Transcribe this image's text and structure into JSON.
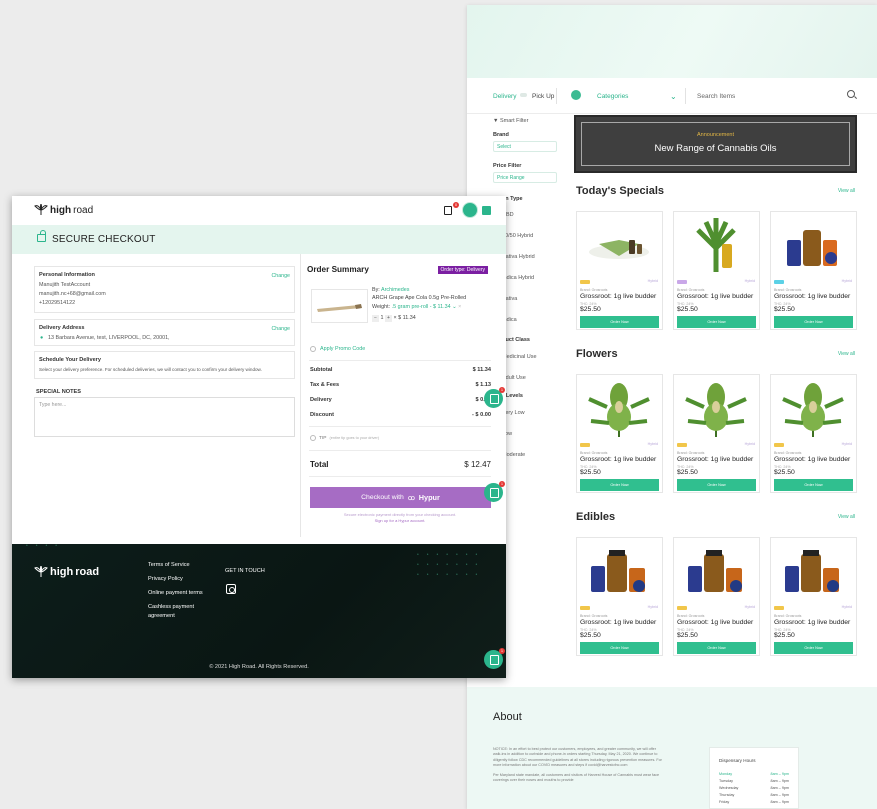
{
  "store": {
    "topbar": {
      "delivery": "Delivery",
      "pickup": "Pick Up",
      "categories": "Categories",
      "search_placeholder": "Search Items"
    },
    "filters": {
      "smart_filter": "Smart Filter",
      "brand_label": "Brand",
      "brand_select": "Select",
      "price_label": "Price Filter",
      "price_select": "Price Range",
      "strain_label": "Strain Type",
      "strains": [
        "CBD",
        "50/50 Hybrid",
        "Sativa Hybrid",
        "Indica Hybrid",
        "Sativa",
        "Indica"
      ],
      "product_class_label": "Product Class",
      "classes": [
        "Medicinal Use",
        "Adult Use"
      ],
      "thc_label": "THC Levels",
      "levels": [
        "Very Low",
        "Low",
        "Moderate"
      ]
    },
    "banner": {
      "announcement": "Announcement",
      "title": "New Range of Cannabis Oils"
    },
    "view_all": "View all",
    "sections": [
      {
        "title": "Today's Specials"
      },
      {
        "title": "Flowers"
      },
      {
        "title": "Edibles"
      }
    ],
    "product": {
      "type": "Hybrid",
      "brand": "Brand: Grosroots",
      "name": "Grossroot: 1g live budder",
      "thc": "THC: 24%",
      "price": "$25.50",
      "order": "Order Now"
    },
    "about": {
      "title": "About",
      "p1": "NOTICE: In an effort to best protect our customers, employees, and greater community, we will offer walk-ins in addition to curbside and phone-in orders starting Thursday, May 21, 2020. We continue to diligently follow CDC recommended guidelines at all stores including rigorous prevention measures. For more information about our COVID measures and steps if covid@harvestofnc.com",
      "p2": "Per Maryland state mandate, all customers and visitors of Harvest House of Cannabis must wear face coverings over their noses and mouths to provide",
      "hours_title": "Dispensary Hours",
      "hours": [
        {
          "day": "Monday",
          "time": "8am – 9pm"
        },
        {
          "day": "Tuesday",
          "time": "8am – 9pm"
        },
        {
          "day": "Wednesday",
          "time": "8am – 9pm"
        },
        {
          "day": "Thursday",
          "time": "8am – 9pm"
        },
        {
          "day": "Friday",
          "time": "8am – 9pm"
        }
      ]
    }
  },
  "checkout": {
    "logo_a": "high",
    "logo_b": "road",
    "cart_count": "0",
    "secure_title": "SECURE CHECKOUT",
    "personal": {
      "heading": "Personal Information",
      "change": "Change",
      "name": "Manujith TestAccount",
      "email": "manujith.nc+68@gmail.com",
      "phone": "+12029514122"
    },
    "delivery": {
      "heading": "Delivery Address",
      "change": "Change",
      "address": "13 Barbara Avenue, test, LIVERPOOL, DC, 20001,"
    },
    "schedule": {
      "heading": "Schedule Your Delivery",
      "text": "Select your delivery preference. For scheduled deliveries, we will contact you to confirm your delivery window."
    },
    "notes": {
      "label": "SPECIAL NOTES",
      "placeholder": "Type here..."
    },
    "summary": {
      "title": "Order Summary",
      "order_type": "Order type: Delivery",
      "by_label": "By:",
      "by_value": "Archimedes",
      "product": "ARCH Grape Ape Cola 0.5g Pre-Rolled",
      "weight_label": "Weight:",
      "weight_value": ".5 gram pre-roll - $ 11.34",
      "qty": "1",
      "line_price": "$ 11.34",
      "promo": "Apply Promo Code",
      "subtotal_label": "Subtotal",
      "subtotal": "$ 11.34",
      "tax_label": "Tax & Fees",
      "tax": "$ 1.13",
      "delivery_label": "Delivery",
      "delivery": "$ 0.00",
      "discount_label": "Discount",
      "discount": "- $ 0.00",
      "tip_label": "TIP",
      "tip_note": "(entire tip goes to your driver)",
      "total_label": "Total",
      "total": "$ 12.47",
      "checkout_label": "Checkout with",
      "hypur": "Hypur",
      "hypur_text1": "Secure electronic payment directly from your checking account.",
      "hypur_text2": "Sign up for a Hypur account."
    },
    "chat_count": "1",
    "footer": {
      "links": [
        "Terms of Service",
        "Privacy Policy",
        "Online payment terms",
        "Cashless payment",
        "agreement"
      ],
      "get_in_touch": "GET IN TOUCH",
      "copyright": "© 2021 High Road. All Rights Reserved."
    }
  },
  "colors": {
    "accent": "#2bb58c",
    "purple": "#a66cc4",
    "order_type": "#7b1fa2",
    "footer": "#0d1d1a"
  }
}
